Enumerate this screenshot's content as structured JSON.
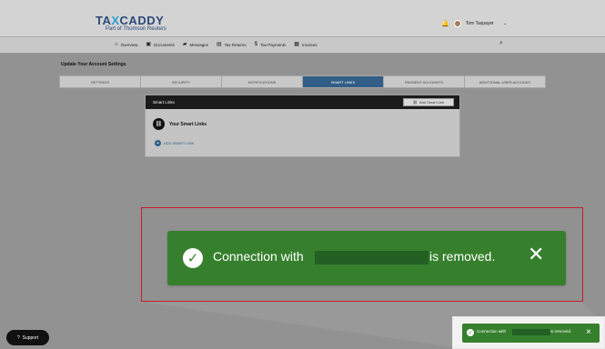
{
  "brand": {
    "name_part1": "TA",
    "name_x": "X",
    "name_part2": "CADDY",
    "tagline": "Part of Thomson Reuters"
  },
  "user": {
    "name": "Tom Taxpayer"
  },
  "nav": {
    "items": [
      {
        "label": "Overview",
        "icon": "home-icon"
      },
      {
        "label": "Documents",
        "icon": "documents-icon"
      },
      {
        "label": "Messages",
        "icon": "messages-icon"
      },
      {
        "label": "Tax Returns",
        "icon": "tax-returns-icon"
      },
      {
        "label": "Tax Payments",
        "icon": "tax-payments-icon"
      },
      {
        "label": "Invoices",
        "icon": "invoices-icon"
      }
    ]
  },
  "page": {
    "title": "Update Your Account Settings"
  },
  "tabs": [
    {
      "label": "SETTINGS"
    },
    {
      "label": "SECURITY"
    },
    {
      "label": "NOTIFICATIONS"
    },
    {
      "label": "SMART LINKS",
      "active": true
    },
    {
      "label": "PAYMENT ACCOUNTS"
    },
    {
      "label": "ADDITIONAL USER ACCOUNT"
    }
  ],
  "smart_links": {
    "title": "Smart Links",
    "add_button": "Add Smart Link",
    "section_title": "Your Smart Links",
    "add_link": "ADD SMART LINK"
  },
  "toast": {
    "prefix": "Connection with",
    "suffix": "is removed."
  },
  "mini_toast": {
    "prefix": "Connection with",
    "suffix": "is removed."
  },
  "support": {
    "label": "Support"
  },
  "colors": {
    "accent": "#315d86",
    "success": "#36802d",
    "highlight_border": "#c51d2e"
  }
}
